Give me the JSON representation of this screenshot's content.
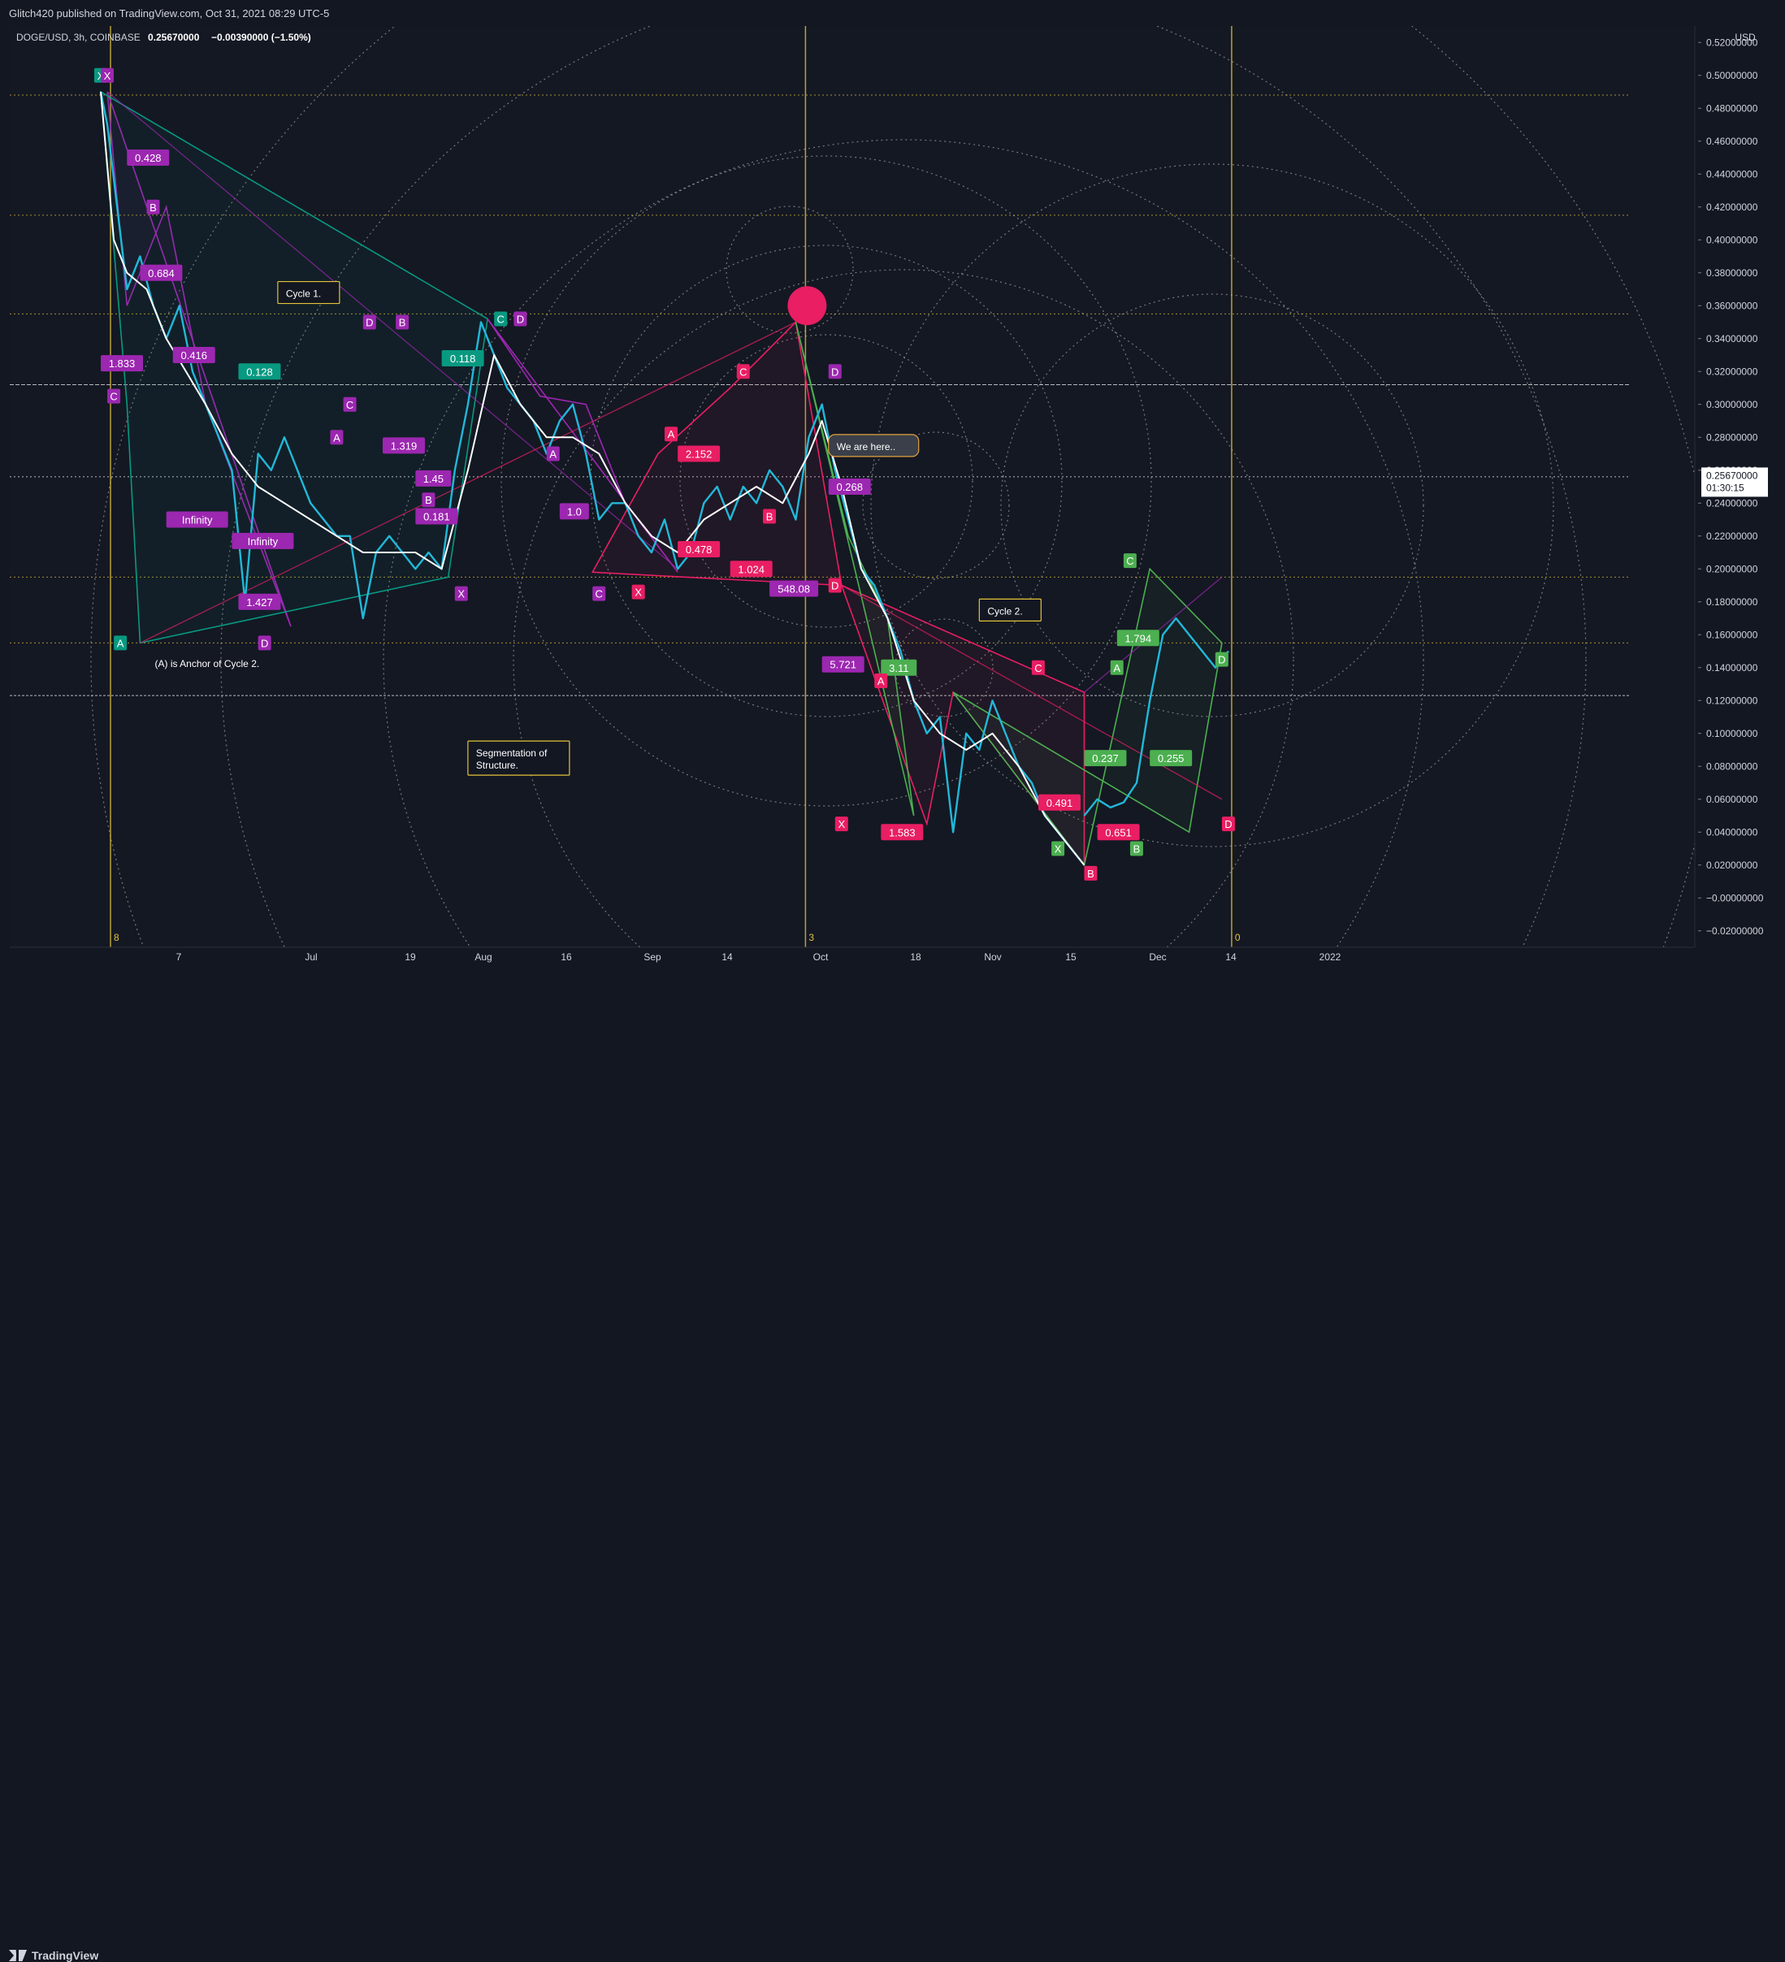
{
  "header": {
    "published_by": "Glitch420 published on TradingView.com, Oct 31, 2021 08:29 UTC-5"
  },
  "legend": {
    "symbol": "DOGE/USD, 3h, COINBASE",
    "price": "0.25670000",
    "change": "−0.00390000 (−1.50%)"
  },
  "footer": {
    "brand": "TradingView"
  },
  "price_axis": {
    "currency": "USD",
    "labels": [
      "0.52000000",
      "0.50000000",
      "0.48000000",
      "0.46000000",
      "0.44000000",
      "0.42000000",
      "0.40000000",
      "0.38000000",
      "0.36000000",
      "0.34000000",
      "0.32000000",
      "0.30000000",
      "0.28000000",
      "0.26000000",
      "0.24000000",
      "0.22000000",
      "0.20000000",
      "0.18000000",
      "0.16000000",
      "0.14000000",
      "0.12000000",
      "0.10000000",
      "0.08000000",
      "0.06000000",
      "0.04000000",
      "0.02000000",
      "−0.00000000",
      "−0.02000000"
    ],
    "current_price": "0.25670000",
    "countdown": "01:30:15"
  },
  "colors": {
    "background": "#131722",
    "text": "#d1d4dc",
    "price_white": "#ffffff",
    "price_cyan": "#22b8d9",
    "purple": "#9c27b0",
    "pink": "#e91e63",
    "teal": "#089981",
    "green": "#4caf50",
    "yellow": "#e3c33a"
  },
  "chart_data": {
    "type": "line",
    "series": [
      {
        "values": [
          [
            0,
            0.49
          ],
          [
            2,
            0.47
          ],
          [
            5,
            0.42
          ],
          [
            8,
            0.37
          ],
          [
            12,
            0.39
          ],
          [
            16,
            0.36
          ],
          [
            20,
            0.34
          ],
          [
            24,
            0.36
          ],
          [
            28,
            0.32
          ],
          [
            32,
            0.3
          ],
          [
            36,
            0.28
          ],
          [
            40,
            0.26
          ],
          [
            44,
            0.18
          ],
          [
            48,
            0.27
          ],
          [
            52,
            0.26
          ],
          [
            56,
            0.28
          ],
          [
            60,
            0.26
          ],
          [
            64,
            0.24
          ],
          [
            68,
            0.23
          ],
          [
            72,
            0.22
          ],
          [
            76,
            0.22
          ],
          [
            80,
            0.17
          ],
          [
            84,
            0.21
          ],
          [
            88,
            0.22
          ],
          [
            92,
            0.21
          ],
          [
            96,
            0.2
          ],
          [
            100,
            0.21
          ],
          [
            104,
            0.2
          ],
          [
            108,
            0.26
          ],
          [
            112,
            0.3
          ],
          [
            116,
            0.35
          ],
          [
            120,
            0.33
          ],
          [
            124,
            0.31
          ],
          [
            128,
            0.3
          ],
          [
            132,
            0.29
          ],
          [
            136,
            0.27
          ],
          [
            140,
            0.29
          ],
          [
            144,
            0.3
          ],
          [
            148,
            0.27
          ],
          [
            152,
            0.23
          ],
          [
            156,
            0.24
          ],
          [
            160,
            0.24
          ],
          [
            164,
            0.22
          ],
          [
            168,
            0.21
          ],
          [
            172,
            0.23
          ],
          [
            176,
            0.2
          ],
          [
            180,
            0.21
          ],
          [
            184,
            0.24
          ],
          [
            188,
            0.25
          ],
          [
            192,
            0.23
          ],
          [
            196,
            0.25
          ],
          [
            200,
            0.24
          ],
          [
            204,
            0.26
          ],
          [
            208,
            0.25
          ],
          [
            212,
            0.23
          ],
          [
            216,
            0.28
          ],
          [
            220,
            0.3
          ],
          [
            224,
            0.26
          ],
          [
            228,
            0.23
          ],
          [
            232,
            0.2
          ],
          [
            236,
            0.19
          ],
          [
            240,
            0.17
          ],
          [
            244,
            0.15
          ],
          [
            248,
            0.12
          ],
          [
            252,
            0.1
          ],
          [
            256,
            0.11
          ],
          [
            260,
            0.04
          ],
          [
            264,
            0.1
          ],
          [
            268,
            0.09
          ],
          [
            272,
            0.12
          ],
          [
            276,
            0.1
          ],
          [
            280,
            0.08
          ],
          [
            284,
            0.07
          ],
          [
            288,
            0.05
          ],
          [
            292,
            0.04
          ],
          [
            296,
            0.03
          ],
          [
            300,
            0.02
          ]
        ]
      },
      {
        "values": [
          [
            0,
            0.49
          ],
          [
            4,
            0.4
          ],
          [
            8,
            0.38
          ],
          [
            14,
            0.37
          ],
          [
            20,
            0.34
          ],
          [
            26,
            0.32
          ],
          [
            32,
            0.3
          ],
          [
            40,
            0.27
          ],
          [
            48,
            0.25
          ],
          [
            56,
            0.24
          ],
          [
            64,
            0.23
          ],
          [
            72,
            0.22
          ],
          [
            80,
            0.21
          ],
          [
            88,
            0.21
          ],
          [
            96,
            0.21
          ],
          [
            104,
            0.2
          ],
          [
            112,
            0.26
          ],
          [
            120,
            0.33
          ],
          [
            128,
            0.3
          ],
          [
            136,
            0.28
          ],
          [
            144,
            0.28
          ],
          [
            152,
            0.27
          ],
          [
            160,
            0.24
          ],
          [
            168,
            0.22
          ],
          [
            176,
            0.21
          ],
          [
            184,
            0.23
          ],
          [
            192,
            0.24
          ],
          [
            200,
            0.25
          ],
          [
            208,
            0.24
          ],
          [
            216,
            0.27
          ],
          [
            220,
            0.29
          ],
          [
            226,
            0.25
          ],
          [
            232,
            0.2
          ],
          [
            240,
            0.17
          ],
          [
            248,
            0.12
          ],
          [
            256,
            0.1
          ],
          [
            264,
            0.09
          ],
          [
            272,
            0.1
          ],
          [
            280,
            0.08
          ],
          [
            288,
            0.05
          ],
          [
            296,
            0.03
          ],
          [
            300,
            0.02
          ]
        ]
      },
      {
        "values": [
          [
            300,
            0.05
          ],
          [
            304,
            0.06
          ],
          [
            308,
            0.055
          ],
          [
            312,
            0.058
          ],
          [
            316,
            0.07
          ],
          [
            320,
            0.12
          ],
          [
            324,
            0.16
          ],
          [
            328,
            0.17
          ],
          [
            332,
            0.16
          ],
          [
            336,
            0.15
          ],
          [
            340,
            0.14
          ],
          [
            344,
            0.15
          ]
        ]
      }
    ],
    "x_ticks": [
      "7",
      "Jul",
      "19",
      "Aug",
      "16",
      "Sep",
      "14",
      "Oct",
      "18",
      "Nov",
      "15",
      "Dec",
      "14",
      "2022"
    ],
    "y_range": [
      -0.03,
      0.53
    ],
    "annotations": {
      "text_boxes": [
        "Cycle 1.",
        "Cycle 2.",
        "We are here..",
        "Segmentation of Structure.",
        "(A) is Anchor of Cycle 2."
      ],
      "ratio_labels": [
        "0.428",
        "0.684",
        "0.416",
        "1.833",
        "0.128",
        "0.118",
        "1.427",
        "Infinity",
        "Infinity",
        "1.319",
        "1.45",
        "0.181",
        "1.0",
        "2.152",
        "0.478",
        "1.024",
        "548.08",
        "0.268",
        "5.721",
        "3.11",
        "1.583",
        "0.237",
        "0.255",
        "0.651",
        "0.491",
        "1.794"
      ],
      "point_labels": [
        "X",
        "X",
        "A",
        "B",
        "C",
        "D",
        "A",
        "C",
        "D",
        "B",
        "A",
        "B",
        "C",
        "D",
        "X",
        "C",
        "A",
        "B",
        "C",
        "D",
        "X",
        "A",
        "B",
        "C",
        "D",
        "X",
        "A",
        "B",
        "C",
        "D",
        "X",
        "D"
      ],
      "vertical_line_labels": [
        "8",
        "3",
        "0"
      ]
    }
  }
}
